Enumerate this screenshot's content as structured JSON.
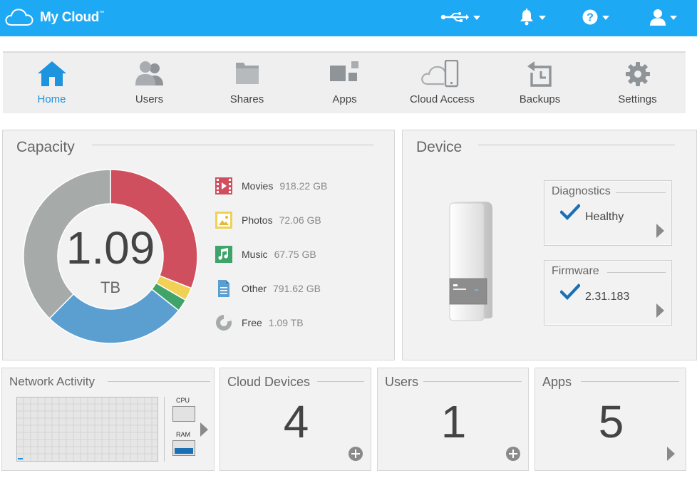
{
  "app": {
    "name": "My Cloud",
    "trademark": "™"
  },
  "header_icons": [
    "usb-icon",
    "bell-icon",
    "help-icon",
    "user-icon"
  ],
  "nav": {
    "items": [
      {
        "label": "Home",
        "icon": "home-icon",
        "active": true
      },
      {
        "label": "Users",
        "icon": "users-icon",
        "active": false
      },
      {
        "label": "Shares",
        "icon": "folder-icon",
        "active": false
      },
      {
        "label": "Apps",
        "icon": "apps-icon",
        "active": false
      },
      {
        "label": "Cloud Access",
        "icon": "cloud-access-icon",
        "active": false
      },
      {
        "label": "Backups",
        "icon": "backups-icon",
        "active": false
      },
      {
        "label": "Settings",
        "icon": "gear-icon",
        "active": false
      }
    ]
  },
  "capacity": {
    "title": "Capacity",
    "total_value": "1.09",
    "total_unit": "TB",
    "legend": [
      {
        "name": "Movies",
        "value": "918.22 GB",
        "icon": "movies-icon",
        "color": "#cf4f5e"
      },
      {
        "name": "Photos",
        "value": "72.06 GB",
        "icon": "photos-icon",
        "color": "#f0d155"
      },
      {
        "name": "Music",
        "value": "67.75 GB",
        "icon": "music-icon",
        "color": "#3fa36a"
      },
      {
        "name": "Other",
        "value": "791.62 GB",
        "icon": "document-icon",
        "color": "#5b9fd1"
      },
      {
        "name": "Free",
        "value": "1.09 TB",
        "icon": "pie-icon",
        "color": "#a6aaa9"
      }
    ],
    "chart_data": {
      "type": "pie",
      "categories": [
        "Movies",
        "Photos",
        "Music",
        "Other",
        "Free"
      ],
      "values": [
        918.22,
        72.06,
        67.75,
        791.62,
        1116.16
      ],
      "units": "GB"
    }
  },
  "device": {
    "title": "Device",
    "diagnostics": {
      "title": "Diagnostics",
      "status": "Healthy"
    },
    "firmware": {
      "title": "Firmware",
      "version": "2.31.183"
    }
  },
  "network": {
    "title": "Network Activity",
    "cpu_label": "CPU",
    "ram_label": "RAM",
    "ram_fill": 0.45
  },
  "cloud_devices": {
    "title": "Cloud Devices",
    "count": "4"
  },
  "users": {
    "title": "Users",
    "count": "1"
  },
  "apps": {
    "title": "Apps",
    "count": "5"
  },
  "colors": {
    "topbar": "#1ea9f5",
    "accent": "#1c94de",
    "check": "#1a6fb5"
  }
}
